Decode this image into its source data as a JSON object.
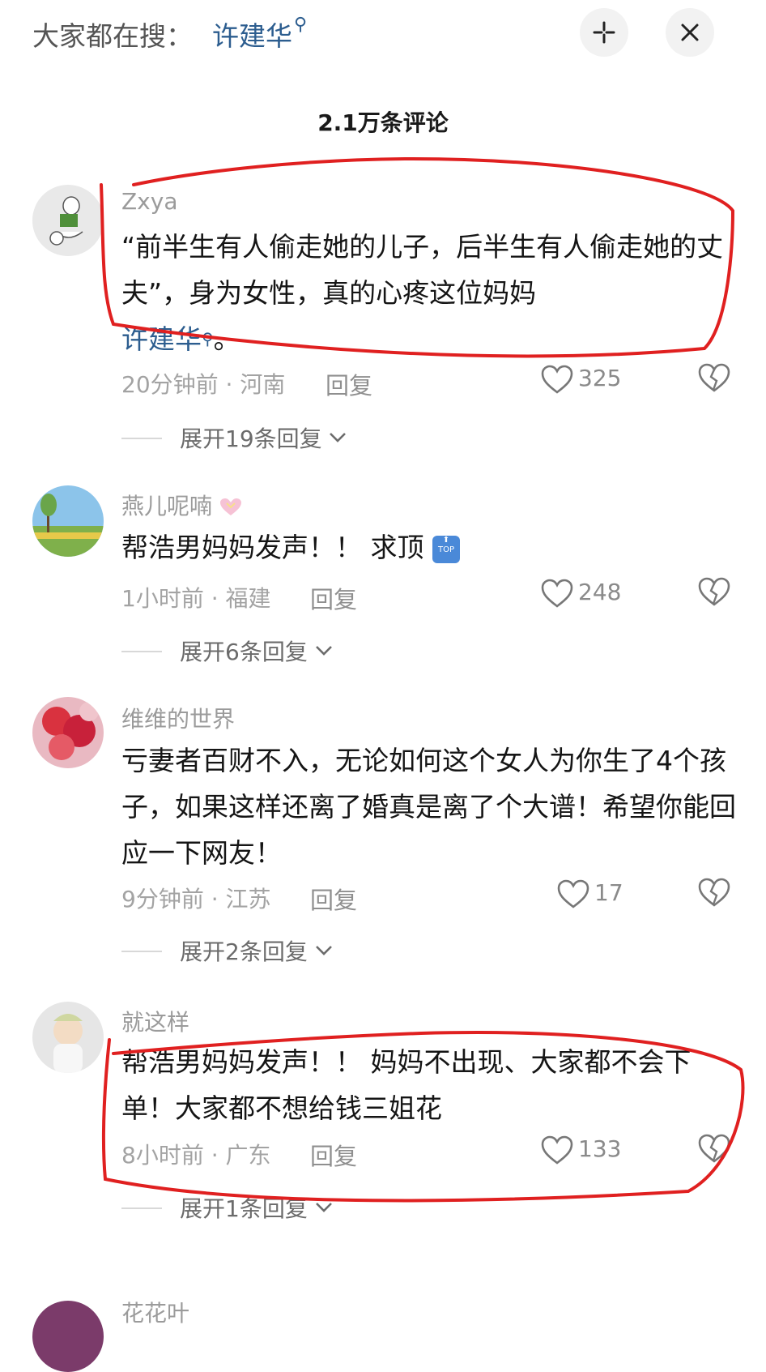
{
  "header": {
    "search_prefix": "大家都在搜：",
    "search_term": "许建华",
    "search_mark": "⚲",
    "comment_count": "2.1万条评论"
  },
  "comments": [
    {
      "user": "Zxya",
      "text": "“前半生有人偷走她的儿子，后半生有人偷走她的丈夫”，身为女性，真的心疼这位妈妈",
      "link": "许建华",
      "link_suffix": "。",
      "meta": "20分钟前 · 河南",
      "reply": "回复",
      "likes": "325",
      "expand": "展开19条回复"
    },
    {
      "user": "燕儿呢喃",
      "text": "帮浩男妈妈发声！！ 求顶",
      "meta": "1小时前 · 福建",
      "reply": "回复",
      "likes": "248",
      "expand": "展开6条回复"
    },
    {
      "user": "维维的世界",
      "text": "亏妻者百财不入，无论如何这个女人为你生了4个孩子，如果这样还离了婚真是离了个大谱！希望你能回应一下网友！",
      "meta": "9分钟前 · 江苏",
      "reply": "回复",
      "likes": "17",
      "expand": "展开2条回复"
    },
    {
      "user": "就这样",
      "text": "帮浩男妈妈发声！！ 妈妈不出现、大家都不会下单！大家都不想给钱三姐花",
      "meta": "8小时前 · 广东",
      "reply": "回复",
      "likes": "133",
      "expand": "展开1条回复"
    },
    {
      "user": "花花叶"
    }
  ],
  "colors": {
    "link": "#2c5d8f",
    "annotation": "#e02020"
  },
  "icons": [
    "search-icon",
    "add-icon",
    "close-icon",
    "heart-icon",
    "broken-heart-icon",
    "chevron-down-icon"
  ]
}
